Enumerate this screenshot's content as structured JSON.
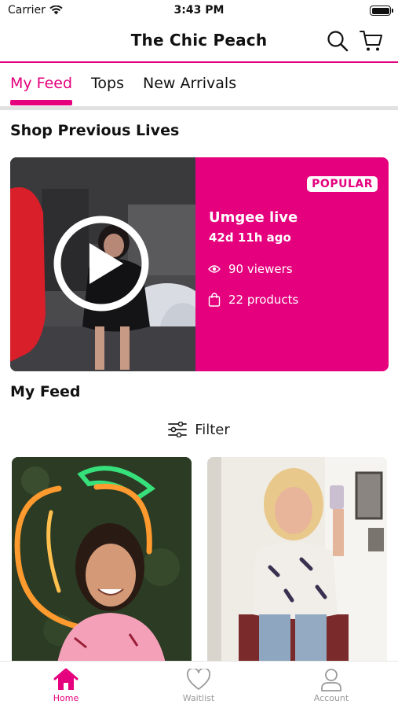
{
  "status_bar": {
    "carrier": "Carrier",
    "time": "3:43 PM"
  },
  "header": {
    "title": "The Chic Peach"
  },
  "tabs": [
    {
      "label": "My Feed",
      "active": true
    },
    {
      "label": "Tops",
      "active": false
    },
    {
      "label": "New Arrivals",
      "active": false
    }
  ],
  "previous_lives": {
    "section_title": "Shop Previous Lives",
    "card": {
      "badge": "POPULAR",
      "name": "Umgee live",
      "ago": "42d 11h ago",
      "viewers": "90 viewers",
      "products": "22 products"
    }
  },
  "feed": {
    "section_title": "My Feed",
    "filter_label": "Filter"
  },
  "bottom_nav": [
    {
      "label": "Home",
      "icon": "home-icon",
      "active": true
    },
    {
      "label": "Waitlist",
      "icon": "heart-icon",
      "active": false
    },
    {
      "label": "Account",
      "icon": "account-icon",
      "active": false
    }
  ],
  "colors": {
    "accent": "#e5007d",
    "text": "#111111",
    "muted": "#9a9a9a"
  }
}
